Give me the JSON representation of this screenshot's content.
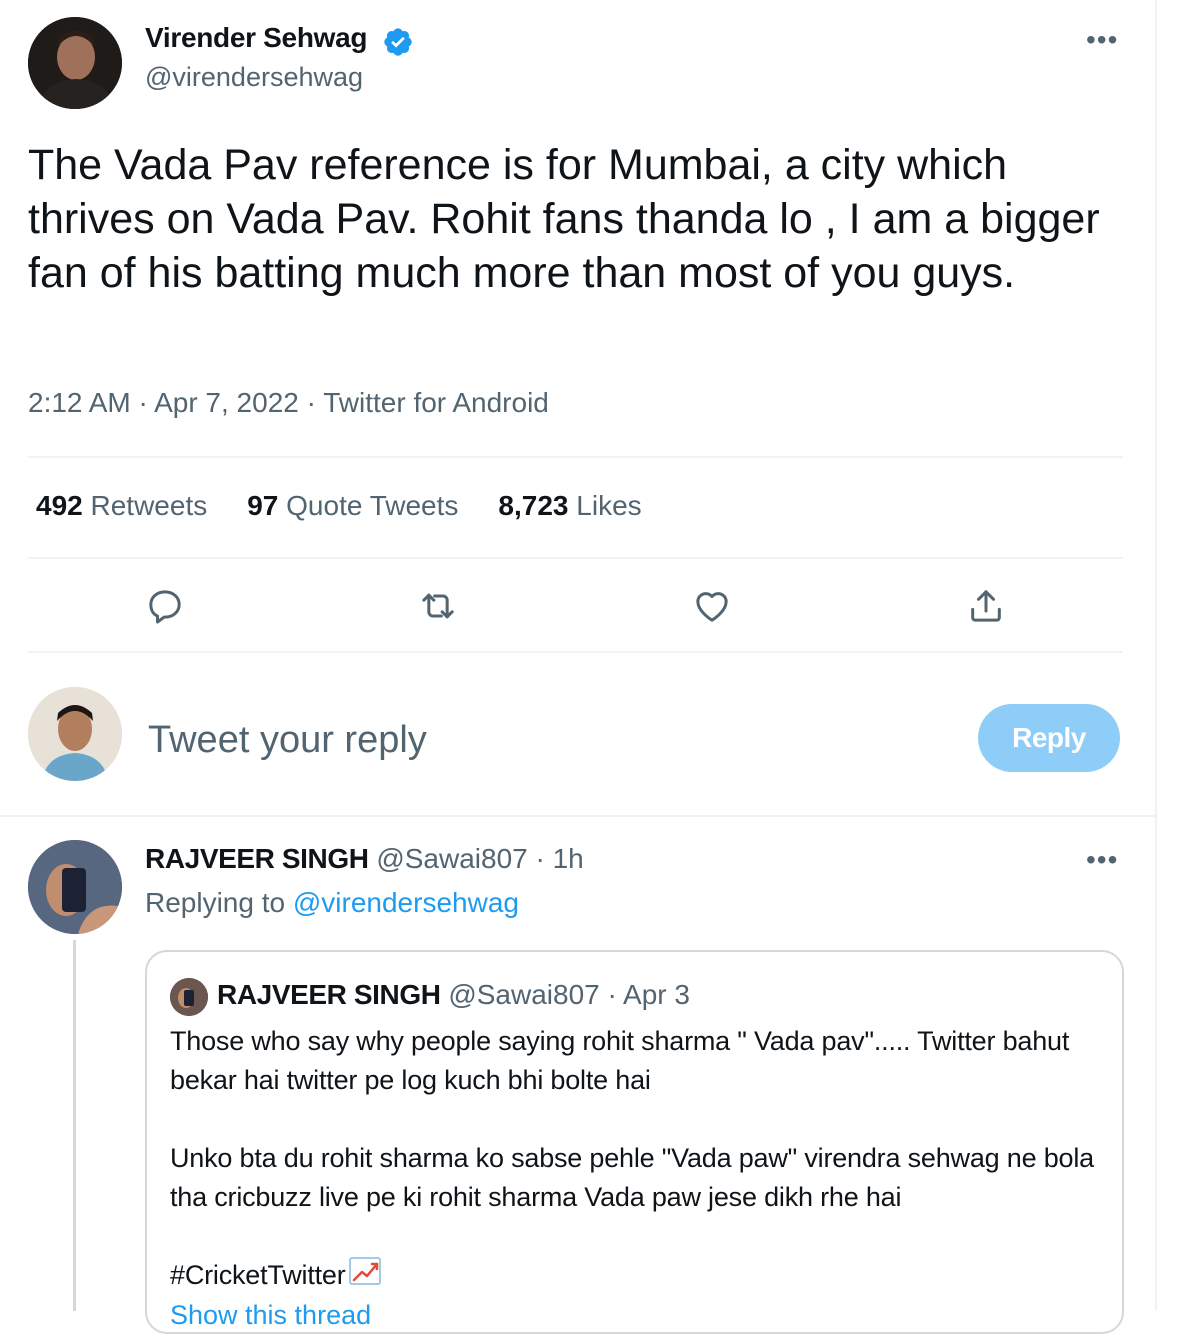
{
  "tweet": {
    "author_name": "Virender Sehwag",
    "handle": "@virendersehwag",
    "text": "The Vada Pav reference is for Mumbai, a city which thrives on Vada Pav. Rohit fans thanda lo , I am a bigger fan of his batting much more than most of you guys.",
    "meta": "2:12 AM · Apr 7, 2022 · Twitter for Android",
    "stats": {
      "retweets_count": "492",
      "retweets_label": "Retweets",
      "quotes_count": "97",
      "quotes_label": "Quote Tweets",
      "likes_count": "8,723",
      "likes_label": "Likes"
    },
    "more_icon": "more-icon",
    "actions": [
      "reply-icon",
      "retweet-icon",
      "like-icon",
      "share-icon"
    ]
  },
  "composer": {
    "placeholder": "Tweet your reply",
    "button_label": "Reply"
  },
  "reply": {
    "author_name": "RAJVEER SINGH",
    "handle": "@Sawai807",
    "time": "· 1h",
    "replying_prefix": "Replying to",
    "replying_to": "@virendersehwag",
    "quoted": {
      "author_name": "RAJVEER SINGH",
      "handle": "@Sawai807",
      "time": "· Apr 3",
      "text": "Those who say why people saying rohit sharma \" Vada pav\"..... Twitter bahut bekar hai twitter pe log kuch bhi bolte hai\n\nUnko bta du rohit sharma ko sabse pehle \"Vada paw\" virendra sehwag ne bola tha cricbuzz live pe ki rohit sharma Vada paw jese dikh rhe hai",
      "hashtag": "#CricketTwitter",
      "show_more": "Show this thread"
    }
  },
  "colors": {
    "accent": "#1d9bf0",
    "reply_button": "#8ecdf8",
    "muted_text": "#536471",
    "divider": "#eff3f4"
  }
}
